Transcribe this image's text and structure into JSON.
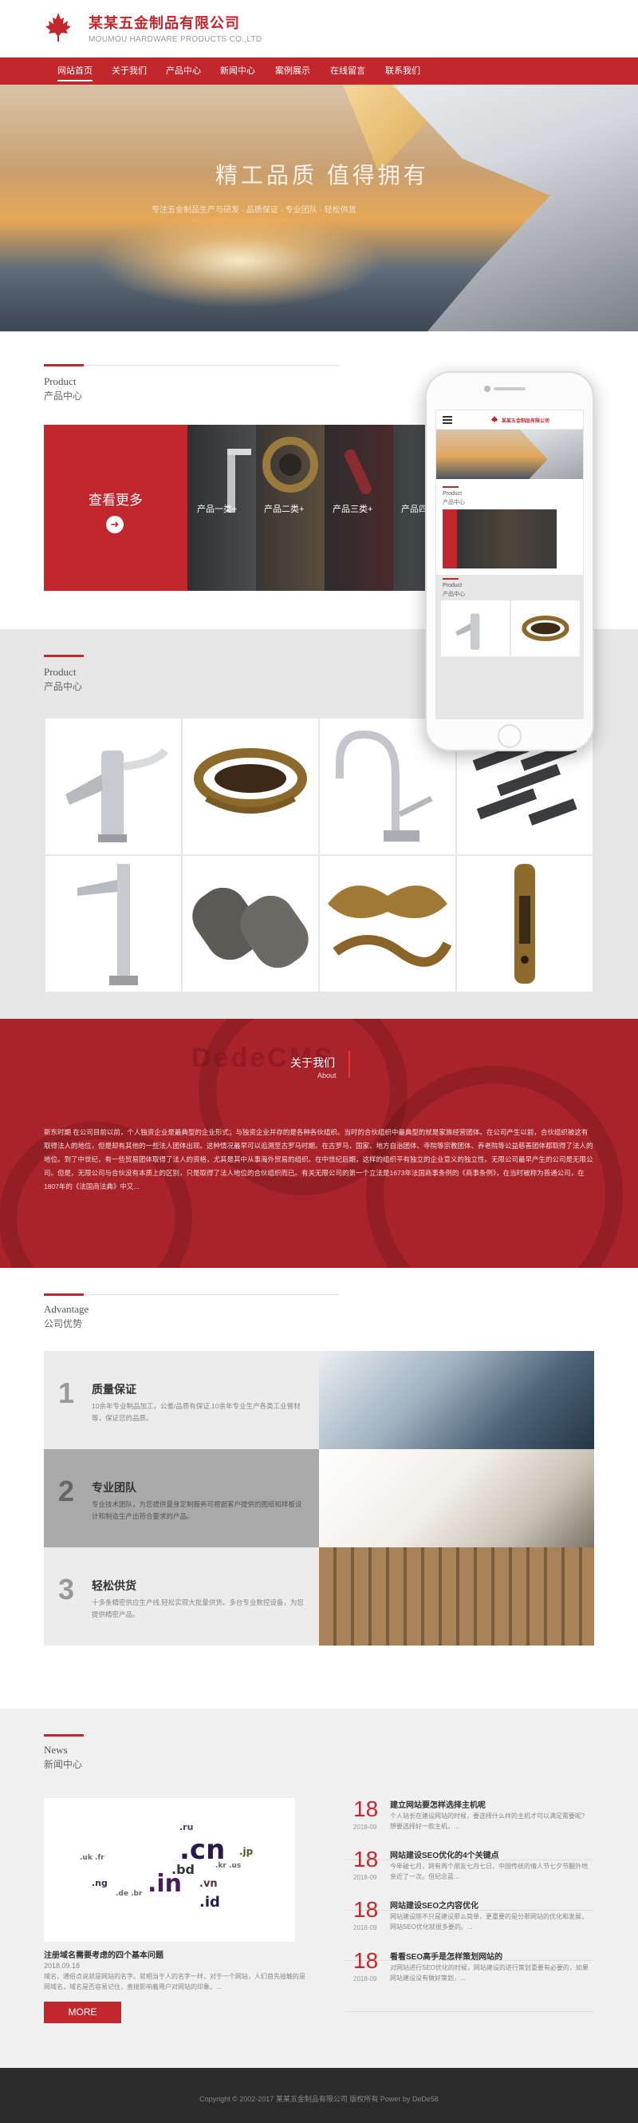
{
  "header": {
    "company_cn": "某某五金制品有限公司",
    "company_en": "MOUMOU HARDWARE PRODUCTS CO.,LTD",
    "brand_color": "#c1272d"
  },
  "nav": {
    "items": [
      "网站首页",
      "关于我们",
      "产品中心",
      "新闻中心",
      "案例展示",
      "在线留言",
      "联系我们"
    ],
    "active_index": 0
  },
  "hero": {
    "title": "精工品质 值得拥有",
    "subtitle": "专注五金制品生产与研发 · 品质保证 · 专业团队 · 轻松供货"
  },
  "product_section": {
    "title_en": "Product",
    "title_cn": "产品中心",
    "more_label": "查看更多",
    "more_icon": "arrow-right-circle-icon",
    "categories": [
      "产品一类+",
      "产品二类+",
      "产品三类+",
      "产品四类+"
    ]
  },
  "product_grid": {
    "title_en": "Product",
    "title_cn": "产品中心",
    "items": [
      "faucet",
      "antique-handle",
      "kitchen-faucet",
      "bolts",
      "sensor-faucet",
      "pipe-fittings",
      "ornament",
      "door-lock"
    ]
  },
  "about": {
    "watermark": "DedeCMS",
    "title": "关于我们",
    "subtitle": "About",
    "text": "新东时期 在公司目前以前，个人独资企业是最典型的企业形式；与独资企业并存的是各种各伙组织。当时的合伙组织中最典型的就是家族经营团体。在公司产生以前，合伙组织被这有取得法人的地位，但是却有其他的一些法人团体出现。这种情况最早可以追溯至古罗马时期。在古罗马，国家、地方自治团体、寺院等宗教团体、养老院等公益慈善团体都取得了法人的地位。到了中世纪，有一些贸易团体取得了法人的资格，尤其是其中从事海外贸易的组织。在中世纪后期，这样的组织平有独立的企业意义的独立性。无限公司最早产生的公司是无限公司。但是，无限公司与合伙没有本质上的区别，只是取得了法人地位的合伙组织而已。有关无限公司的第一个立法是1673年法国商事条例的《商事条例》，在当时被称为普通公司，在1807年的《法国商法典》中又..."
  },
  "advantage": {
    "title_en": "Advantage",
    "title_cn": "公司优势",
    "items": [
      {
        "num": "1",
        "title": "质量保证",
        "desc": "10余年专业制品加工，公差/品质有保证,10余年专业生产各类工业管材等，保证您的品质。"
      },
      {
        "num": "2",
        "title": "专业团队",
        "desc": "专业技术团队，为您提供量身定制服务可根据客户提供的图纸和样板设计和制造生产出符合要求的产品。"
      },
      {
        "num": "3",
        "title": "轻松供货",
        "desc": "十多条精密供应生产线,轻松实现大批量供货。多台专业数控设备，为您提供精密产品。"
      }
    ]
  },
  "news": {
    "title_en": "News",
    "title_cn": "新闻中心",
    "featured": {
      "title": "注册域名需要考虑的四个基本问题",
      "date": "2018.09.18",
      "summary": "域名，通俗点说就是网站的名字。就相当于人的名字一样，对于一个网站，人们首先接触的是网域名，域名是否容易记住，直接影响着用户对网站的印象。..."
    },
    "more_label": "MORE",
    "items": [
      {
        "day": "18",
        "ym": "2018-09",
        "title": "建立网站要怎样选择主机呢",
        "summary": "个人站长在建设网站的时候，要选择什么样的主机才可以满足需要呢？想要选择好一款主机，..."
      },
      {
        "day": "18",
        "ym": "2018-09",
        "title": "网站建设SEO优化的4个关键点",
        "summary": "今年碰七月，跨有再个朋友七月七日，中国传统的情人节七夕节翻外地亲近了一次。但纪念蓝..."
      },
      {
        "day": "18",
        "ym": "2018-09",
        "title": "网站建设SEO之内容优化",
        "summary": "网站建设除不只是建设那么简单，更重要的是分那网站的优化和发展，网站SEO优化就很多要的。..."
      },
      {
        "day": "18",
        "ym": "2018-09",
        "title": "看看SEO高手是怎样策划网站的",
        "summary": "对网站进行SEO优化的时候，网站建设的进行策划重要有必要的，如果网站建设没有做好策划，..."
      }
    ]
  },
  "footer": {
    "text": "Copyright © 2002-2017 某某五金制品有限公司 版权所有 Power by DeDe58"
  },
  "phone_mockup": {
    "company_cn": "某某五金制品有限公司",
    "title_en": "Product",
    "title_cn": "产品中心"
  }
}
